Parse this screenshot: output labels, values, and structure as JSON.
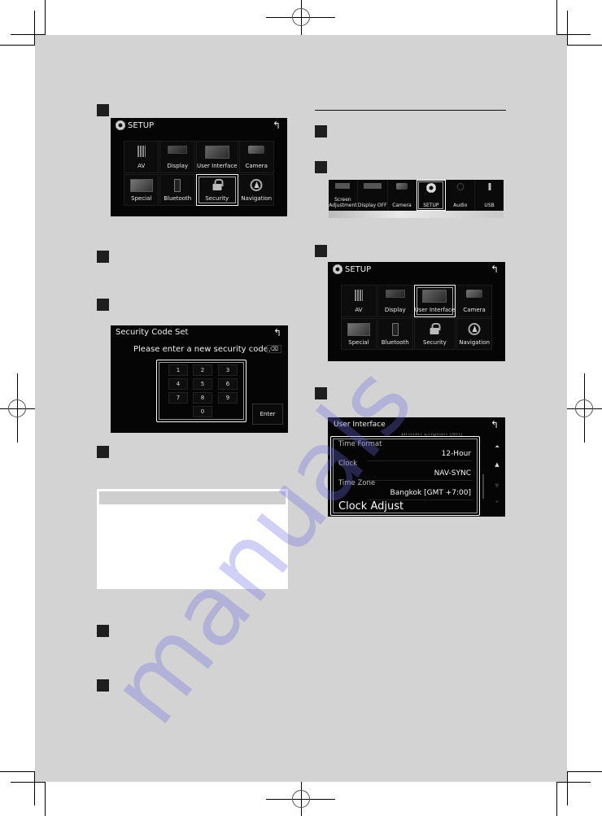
{
  "steps": {
    "left": [
      {
        "id": "L1"
      },
      {
        "id": "L2"
      },
      {
        "id": "L3"
      },
      {
        "id": "L4"
      },
      {
        "id": "L5"
      },
      {
        "id": "L6"
      }
    ],
    "right": [
      {
        "id": "R1"
      },
      {
        "id": "R2"
      },
      {
        "id": "R3"
      },
      {
        "id": "R4"
      }
    ]
  },
  "setup_screen_security": {
    "title": "SETUP",
    "back_icon": "↰",
    "tiles": [
      {
        "label": "AV",
        "icon": "av-icon"
      },
      {
        "label": "Display",
        "icon": "display-icon"
      },
      {
        "label": "User Interface",
        "icon": "user-interface-icon"
      },
      {
        "label": "Camera",
        "icon": "camera-icon"
      },
      {
        "label": "Special",
        "icon": "special-icon"
      },
      {
        "label": "Bluetooth",
        "icon": "bluetooth-icon"
      },
      {
        "label": "Security",
        "icon": "lock-icon"
      },
      {
        "label": "Navigation",
        "icon": "navigation-icon"
      }
    ],
    "selected": "Security"
  },
  "security_code_screen": {
    "title": "Security Code Set",
    "back_icon": "↰",
    "prompt": "Please enter a new security code.",
    "backspace_icon": "⌫",
    "keys": [
      "1",
      "2",
      "3",
      "4",
      "5",
      "6",
      "7",
      "8",
      "9",
      "0"
    ],
    "enter_label": "Enter"
  },
  "source_bar": {
    "items": [
      {
        "label": "Screen\nAdjustment",
        "line1": "Screen",
        "line2": "Adjustment"
      },
      {
        "label": "Display OFF"
      },
      {
        "label": "Camera"
      },
      {
        "label": "SETUP"
      },
      {
        "label": "Audio"
      },
      {
        "label": "USB"
      }
    ],
    "selected": "SETUP"
  },
  "setup_screen_ui": {
    "title": "SETUP",
    "back_icon": "↰",
    "tiles": [
      {
        "label": "AV"
      },
      {
        "label": "Display"
      },
      {
        "label": "User Interface"
      },
      {
        "label": "Camera"
      },
      {
        "label": "Special"
      },
      {
        "label": "Bluetooth"
      },
      {
        "label": "Security"
      },
      {
        "label": "Navigation"
      }
    ],
    "selected": "User Interface"
  },
  "user_interface_screen": {
    "title": "User Interface",
    "back_icon": "↰",
    "faded_row_value": "British English (en)",
    "rows": [
      {
        "label": "Time Format",
        "value": "12-Hour"
      },
      {
        "label": "Clock",
        "value": "NAV-SYNC"
      },
      {
        "label": "Time Zone",
        "value": "Bangkok [GMT +7:00]"
      }
    ],
    "action_row": "Clock Adjust",
    "scroll_buttons": {
      "top": "⏶",
      "up": "▲",
      "down": "▼",
      "bottom": "⏷"
    }
  },
  "watermark": "manuals"
}
